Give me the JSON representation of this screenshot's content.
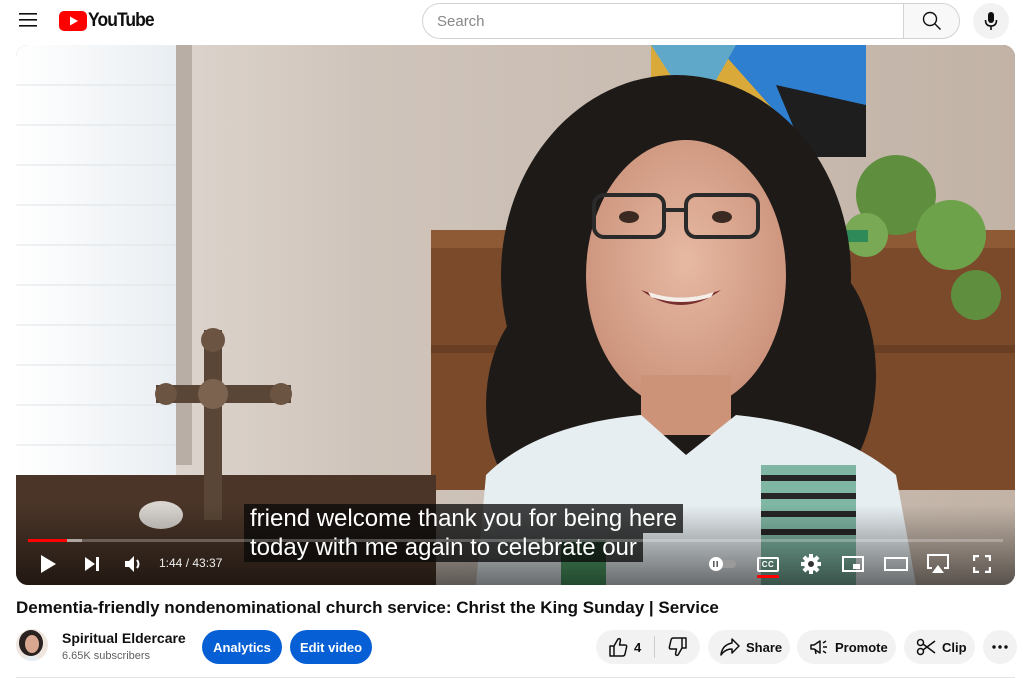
{
  "header": {
    "logo_text": "YouTube",
    "search_placeholder": "Search"
  },
  "player": {
    "captions": [
      "friend welcome thank you for being here",
      "today with me again to celebrate our"
    ],
    "time_display": "1:44 / 43:37",
    "progress_fraction": 0.04,
    "buffer_fraction": 0.055
  },
  "video": {
    "title": "Dementia-friendly nondenominational church service: Christ the King Sunday | Service"
  },
  "channel": {
    "name": "Spiritual Eldercare",
    "subscribers": "6.65K subscribers"
  },
  "actions": {
    "analytics_label": "Analytics",
    "edit_label": "Edit video",
    "like_count": "4",
    "share_label": "Share",
    "promote_label": "Promote",
    "clip_label": "Clip"
  },
  "colors": {
    "brand_red": "#ff0000",
    "accent_blue": "#065fd4"
  },
  "icons": [
    "menu-icon",
    "youtube-play-icon",
    "search-icon",
    "mic-icon",
    "play-icon",
    "next-icon",
    "volume-icon",
    "autoplay-toggle-icon",
    "cc-icon",
    "settings-gear-icon",
    "miniplayer-icon",
    "theater-mode-icon",
    "airplay-icon",
    "fullscreen-icon",
    "thumbs-up-icon",
    "thumbs-down-icon",
    "share-icon",
    "promote-icon",
    "scissors-icon",
    "more-icon"
  ]
}
